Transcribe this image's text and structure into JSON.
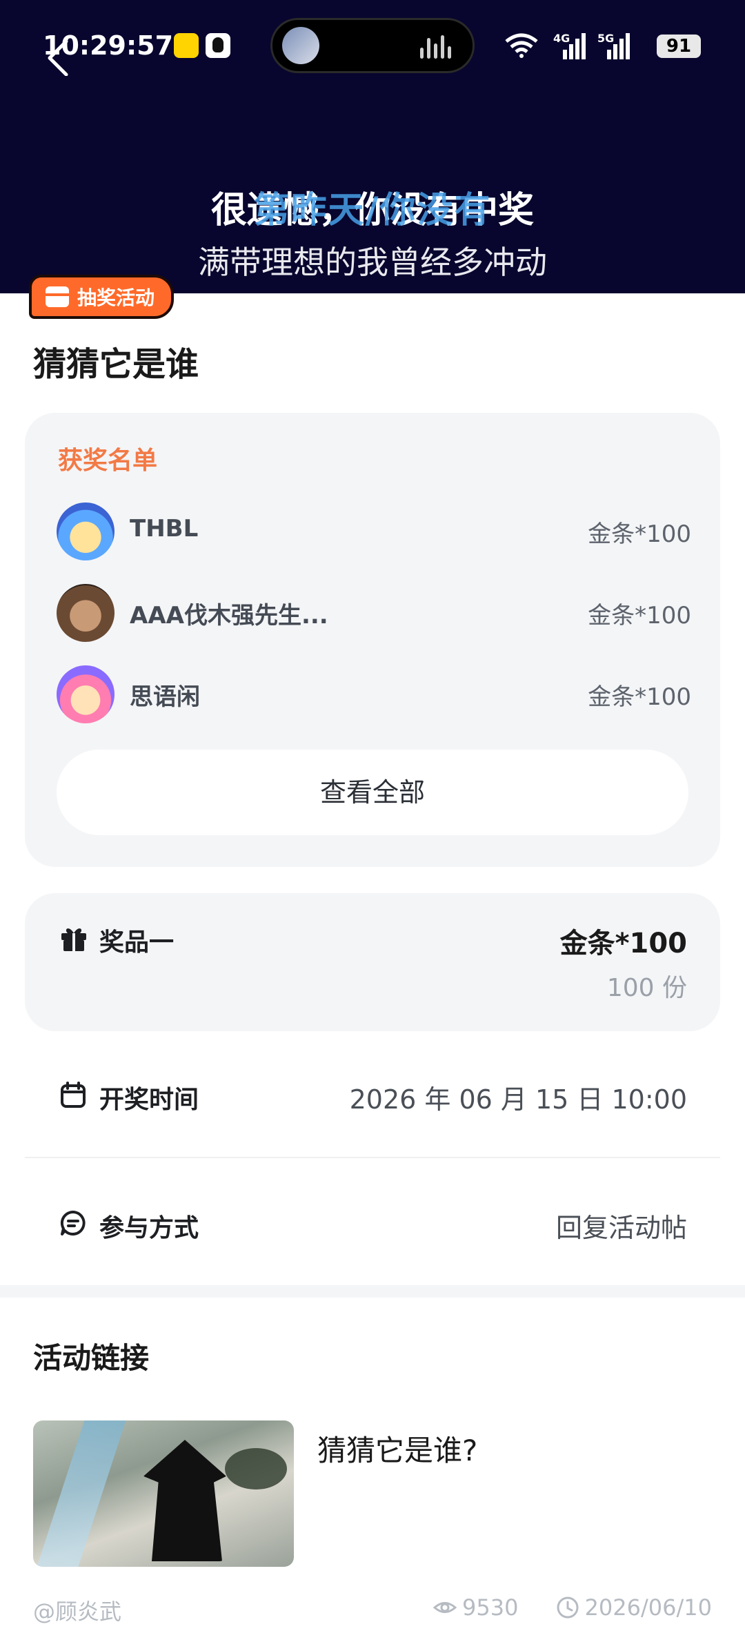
{
  "status_bar": {
    "time": "10:29:57",
    "battery": "91",
    "network_4g": "4G",
    "network_5g": "5G"
  },
  "header": {
    "lyric_main": "很遗憾，你没有中奖",
    "lyric_overlay": "第昨天/你没有",
    "lyric_sub": "满带理想的我曾经多冲动"
  },
  "tag": {
    "label": "抽奖活动"
  },
  "page_title": "猜猜它是谁",
  "winners": {
    "title": "获奖名单",
    "items": [
      {
        "name": "THBL",
        "prize": "金条*100"
      },
      {
        "name": "AAA伐木强先生...",
        "prize": "金条*100"
      },
      {
        "name": "思语闲",
        "prize": "金条*100"
      }
    ],
    "view_all": "查看全部"
  },
  "prize": {
    "label": "奖品一",
    "value": "金条*100",
    "count": "100 份"
  },
  "draw_time": {
    "label": "开奖时间",
    "value": "2026 年 06 月 15 日 10:00"
  },
  "participation": {
    "label": "参与方式",
    "value": "回复活动帖"
  },
  "activity_link": {
    "title": "活动链接",
    "text": "猜猜它是谁?",
    "author": "@顾炎武",
    "views": "9530",
    "date": "2026/06/10"
  },
  "colors": {
    "header_bg": "#08062e",
    "accent_orange": "#ff6a2a",
    "winners_title": "#f27a46",
    "card_bg": "#f4f5f7"
  }
}
